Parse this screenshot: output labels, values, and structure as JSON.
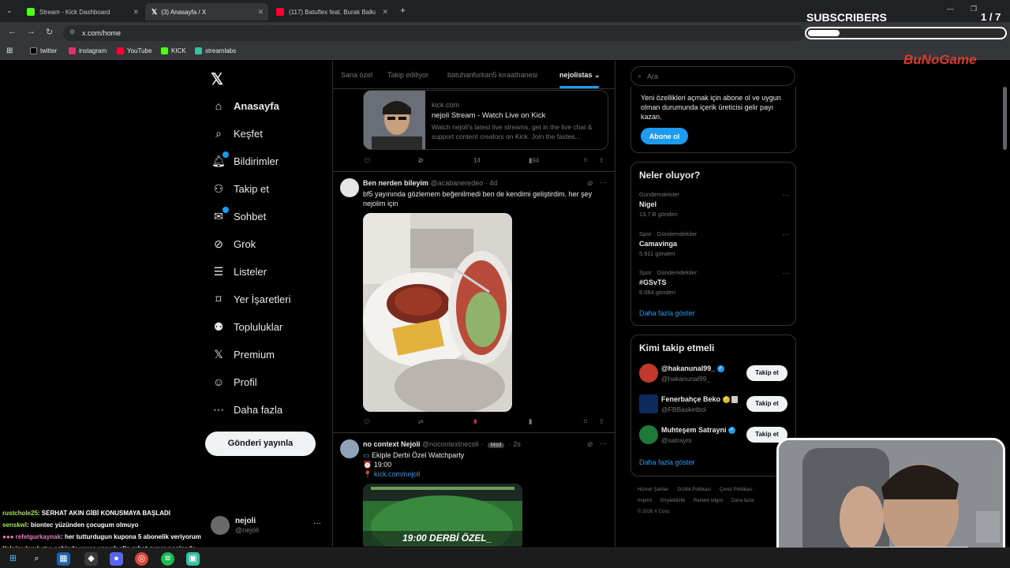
{
  "browser": {
    "tabs": [
      {
        "label": "Stream - Kick Dashboard",
        "color": "#53fc18"
      },
      {
        "label": "(3) Anasayfa / X",
        "color": "#000000"
      },
      {
        "label": "(117) Batuflex feat. Burak Balka",
        "color": "#ff0033"
      }
    ],
    "url": "x.com/home",
    "bookmarks": [
      {
        "label": "twitter",
        "color": "#000000"
      },
      {
        "label": "instagram",
        "color": "#e1306c"
      },
      {
        "label": "YouTube",
        "color": "#ff0033"
      },
      {
        "label": "KICK",
        "color": "#53fc18"
      },
      {
        "label": "streamlabs",
        "color": "#31c3a2"
      }
    ]
  },
  "overlay": {
    "subscribers_label": "SUBSCRIBERS",
    "count": "1 / 7",
    "progress_fraction": 0.14,
    "brand": "BuNoGame"
  },
  "sidebar": {
    "items": [
      {
        "label": "Anasayfa",
        "icon": "home-icon"
      },
      {
        "label": "Keşfet",
        "icon": "search-icon"
      },
      {
        "label": "Bildirimler",
        "icon": "bell-icon"
      },
      {
        "label": "Takip et",
        "icon": "person-add-icon"
      },
      {
        "label": "Sohbet",
        "icon": "mail-icon"
      },
      {
        "label": "Grok",
        "icon": "grok-icon"
      },
      {
        "label": "Listeler",
        "icon": "list-icon"
      },
      {
        "label": "Yer İşaretleri",
        "icon": "bookmark-icon"
      },
      {
        "label": "Topluluklar",
        "icon": "people-icon"
      },
      {
        "label": "Premium",
        "icon": "x-icon"
      },
      {
        "label": "Profil",
        "icon": "person-icon"
      },
      {
        "label": "Daha fazla",
        "icon": "more-circle-icon"
      }
    ],
    "post_button": "Gönderi yayınla",
    "user": {
      "name": "nejoli",
      "handle": "@nejoli",
      "more": "···"
    }
  },
  "timeline": {
    "tabs": [
      "Sana özel",
      "Takip ediliyor",
      "batuhanfurkan5 kıraathanesi",
      "nejolistas"
    ],
    "card": {
      "domain": "kick.com",
      "title": "nejoli Stream - Watch Live on Kick",
      "desc": "Watch nejoli's latest live streams, get in the live chat & support content creators on Kick. Join the fastes..."
    },
    "card_actions": {
      "reposts": "2",
      "likes": "14",
      "views": "194"
    },
    "tweet1": {
      "name": "Ben nerden bileyim",
      "handle": "@acabaneredeo · 4d",
      "text": "bf5 yayınında gözlemem beğenilmedi ben de kendimi geliştirdim. her şey nejolim için",
      "likes": "2",
      "views": "5"
    },
    "tweet2": {
      "name": "no context Nejoli",
      "handle": "@nocontextnecoli ·",
      "mod": "Mod",
      "time": "· 2s",
      "line1": "Ekiple Derbi Özel Watchparty",
      "line2": "19:00",
      "line3": "kick.com/nejoli",
      "image_text": "19:00 DERBİ ÖZEL_"
    }
  },
  "right": {
    "search_placeholder": "Ara",
    "premium_text": "Yeni özellikleri açmak için abone ol ve uygun olman durumunda içerik üreticisi gelir payı kazan.",
    "subscribe_button": "Abone ol",
    "trends_title": "Neler oluyor?",
    "trends": [
      {
        "context": "Gündemdekiler",
        "topic": "Nigel",
        "posts": "13,7 B gönderi"
      },
      {
        "context": "Spor · Gündemdekiler",
        "topic": "Camavinga",
        "posts": "5.911 gönderi"
      },
      {
        "context": "Spor · Gündemdekiler",
        "topic": "#GSvTS",
        "posts": "8.084 gönderi"
      }
    ],
    "show_more": "Daha fazla göster",
    "who_title": "Kimi takip etmeli",
    "who": [
      {
        "name": "@hakanunal99_",
        "handle": "@hakanunal99_",
        "button": "Takip et",
        "color": "#c0392b"
      },
      {
        "name": "Fenerbahçe Beko",
        "handle": "@FBBasketbol",
        "button": "Takip et",
        "color": "#0e2a5c"
      },
      {
        "name": "Muhteşem Satrayni",
        "handle": "@satrayni",
        "button": "Takip et",
        "color": "#1f7a3a"
      }
    ],
    "who_show_more": "Daha fazla göster",
    "footer": [
      "Hizmet Şartları",
      "Gizlilik Politikası",
      "Çerez Politikası",
      "Imprint",
      "Erişilebilirlik",
      "Reklam bilgisi",
      "Daha fazla",
      "© 2026 X Corp."
    ]
  },
  "chat": [
    {
      "user": "rustchole25",
      "msg": ": SERHAT AKIN GİBİ KONUSMAYA BAŞLADI"
    },
    {
      "user": "senskwl",
      "msg": ": biontec yüzünden çocugum olmuyo"
    },
    {
      "user": "refetgurkaynak",
      "msg": ": her tutturdugun kupona 5 abonelik veriyorum"
    },
    {
      "user": "Yalnizadambatu",
      "msg": ": cebinde varsa yancık elin rahat oynar nesinede"
    }
  ]
}
